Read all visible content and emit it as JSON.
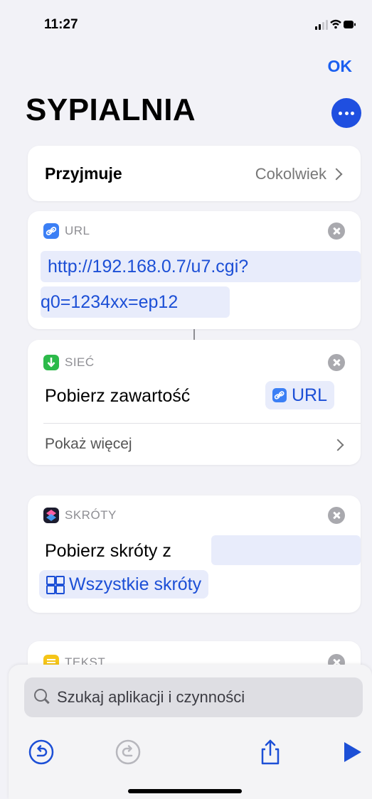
{
  "status_bar": {
    "time": "11:27"
  },
  "nav": {
    "ok_label": "OK",
    "title": "SYPIALNIA"
  },
  "accepts": {
    "label": "Przyjmuje",
    "value": "Cokolwiek"
  },
  "url_action": {
    "category": "URL",
    "url_line1": "http://192.168.0.7/u7.cgi?",
    "url_line2": "q0=1234xx=ep12"
  },
  "network_action": {
    "category": "SIEĆ",
    "action_label": "Pobierz zawartość",
    "param_label": "URL",
    "show_more": "Pokaż więcej"
  },
  "shortcuts_action": {
    "category": "SKRÓTY",
    "action_label": "Pobierz skróty z",
    "param_label": "Wszystkie skróty"
  },
  "text_action": {
    "category": "TEKST"
  },
  "search": {
    "placeholder": "Szukaj aplikacji i czynności"
  },
  "colors": {
    "accent": "#1c4fd6",
    "background": "#f2f2f7"
  }
}
